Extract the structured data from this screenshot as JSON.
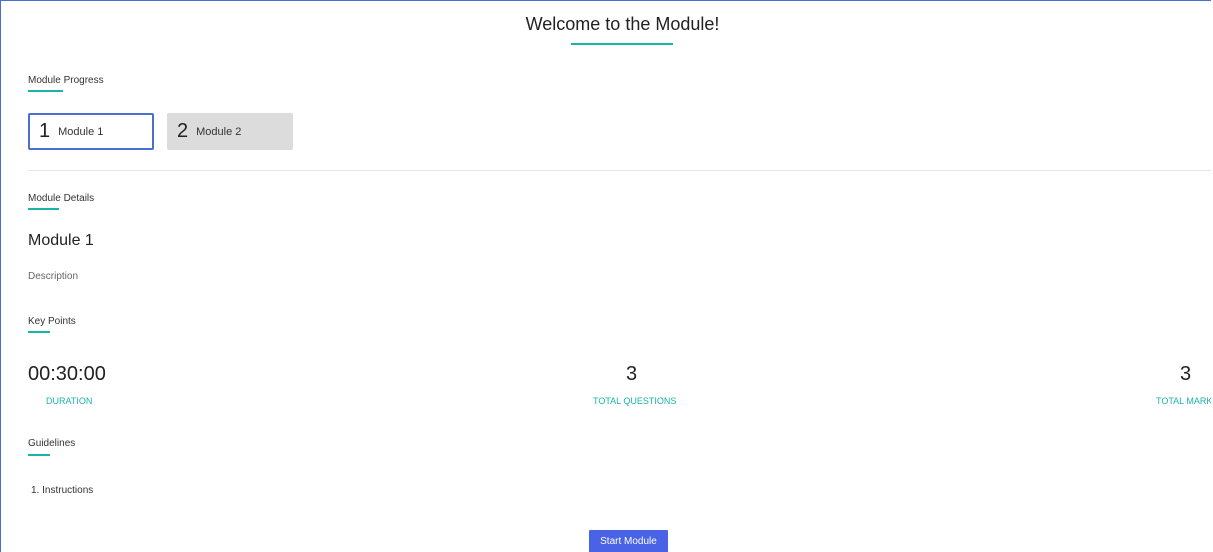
{
  "header": {
    "title": "Welcome to the Module!"
  },
  "progress": {
    "label": "Module Progress",
    "steps": [
      {
        "number": "1",
        "label": "Module 1",
        "state": "active"
      },
      {
        "number": "2",
        "label": "Module 2",
        "state": "inactive"
      }
    ]
  },
  "details": {
    "label": "Module Details",
    "module_name": "Module 1",
    "description": "Description"
  },
  "key_points": {
    "label": "Key Points",
    "items": [
      {
        "value": "00:30:00",
        "label": "DURATION"
      },
      {
        "value": "3",
        "label": "TOTAL QUESTIONS"
      },
      {
        "value": "3",
        "label": "TOTAL MARKS"
      }
    ]
  },
  "guidelines": {
    "label": "Guidelines",
    "items": [
      "1. Instructions"
    ]
  },
  "actions": {
    "start_label": "Start Module"
  },
  "colors": {
    "accent": "#1bb3a8",
    "primary": "#4a63e6",
    "border": "#4a6fd1"
  }
}
